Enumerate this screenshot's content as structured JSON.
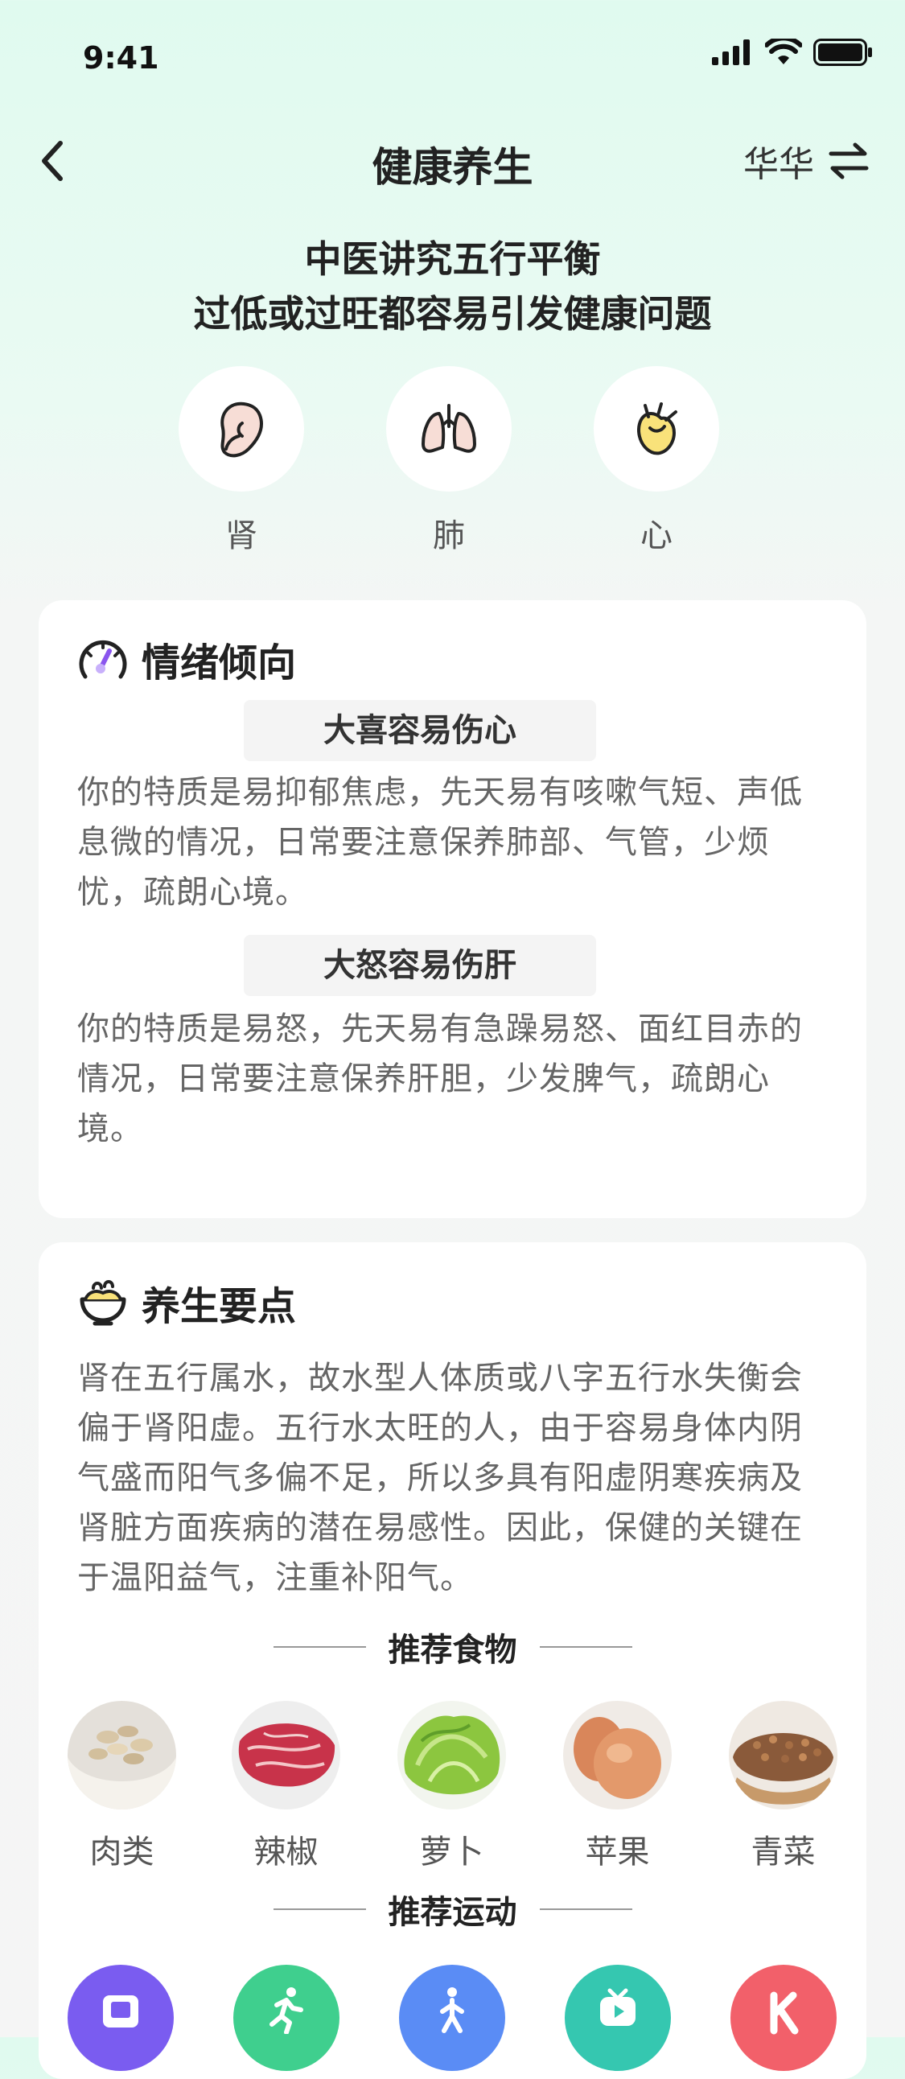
{
  "status": {
    "time": "9:41"
  },
  "nav": {
    "title": "健康养生",
    "user": "华华"
  },
  "intro": {
    "line1": "中医讲究五行平衡",
    "line2": "过低或过旺都容易引发健康问题"
  },
  "organs": [
    {
      "label": "肾",
      "icon": "kidney-icon"
    },
    {
      "label": "肺",
      "icon": "lungs-icon"
    },
    {
      "label": "心",
      "icon": "heart-icon"
    }
  ],
  "emotion": {
    "title": "情绪倾向",
    "icon": "gauge-icon",
    "items": [
      {
        "tag": "大喜容易伤心",
        "text": "你的特质是易抑郁焦虑，先天易有咳嗽气短、声低息微的情况，日常要注意保养肺部、气管，少烦忧，疏朗心境。"
      },
      {
        "tag": "大怒容易伤肝",
        "text": "你的特质是易怒，先天易有急躁易怒、面红目赤的情况，日常要注意保养肝胆，少发脾气，疏朗心境。"
      }
    ]
  },
  "health": {
    "title": "养生要点",
    "icon": "bowl-icon",
    "text": "肾在五行属水，故水型人体质或八字五行水失衡会偏于肾阳虚。五行水太旺的人，由于容易身体内阴气盛而阳气多偏不足，所以多具有阳虚阴寒疾病及肾脏方面疾病的潜在易感性。因此，保健的关键在于温阳益气，注重补阳气。",
    "food_title": "推荐食物",
    "foods": [
      {
        "label": "肉类",
        "image": "oats-image"
      },
      {
        "label": "辣椒",
        "image": "beef-image"
      },
      {
        "label": "萝卜",
        "image": "lettuce-image"
      },
      {
        "label": "苹果",
        "image": "egg-image"
      },
      {
        "label": "青菜",
        "image": "buckwheat-image"
      }
    ],
    "sport_title": "推荐运动",
    "sports": [
      {
        "icon": "book-app-icon",
        "color": "#7a5cf0"
      },
      {
        "icon": "running-app-icon",
        "color": "#3fcf8e"
      },
      {
        "icon": "walking-app-icon",
        "color": "#5a8cf5"
      },
      {
        "icon": "tv-app-icon",
        "color": "#35c7b0"
      },
      {
        "icon": "k-app-icon",
        "color": "#f2606a"
      }
    ]
  }
}
